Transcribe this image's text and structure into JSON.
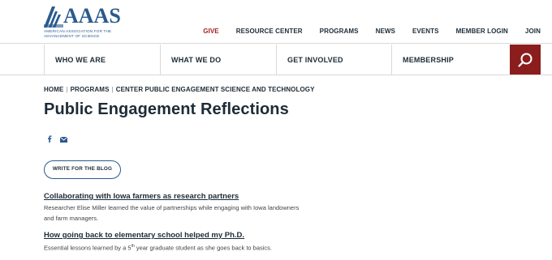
{
  "logo": {
    "word": "AAAS",
    "subtitle": "American Association for the Advancement of Science"
  },
  "utility_nav": [
    {
      "label": "GIVE",
      "accent": "#a32020"
    },
    {
      "label": "RESOURCE CENTER"
    },
    {
      "label": "PROGRAMS"
    },
    {
      "label": "NEWS"
    },
    {
      "label": "EVENTS"
    },
    {
      "label": "MEMBER LOGIN"
    },
    {
      "label": "JOIN"
    }
  ],
  "main_nav": [
    {
      "label": "WHO WE ARE"
    },
    {
      "label": "WHAT WE DO"
    },
    {
      "label": "GET INVOLVED"
    },
    {
      "label": "MEMBERSHIP"
    }
  ],
  "search": {
    "icon": "search-icon",
    "color": "#8b1d1d"
  },
  "breadcrumb": [
    "HOME",
    "PROGRAMS",
    "CENTER PUBLIC ENGAGEMENT SCIENCE AND TECHNOLOGY"
  ],
  "page_title": "Public Engagement Reflections",
  "share_icons": [
    "facebook-icon",
    "email-icon"
  ],
  "cta": {
    "label": "WRITE FOR THE BLOG"
  },
  "articles": [
    {
      "title": "Collaborating with Iowa farmers as research partners",
      "description": "Researcher Elise Miller learned the value of partnerships while engaging with Iowa landowners and farm managers."
    },
    {
      "title": "How going back to elementary school helped my Ph.D.",
      "description_pre": "Essential lessons learned by a 5",
      "description_sup": "th",
      "description_post": " year graduate student as she goes back to basics."
    }
  ],
  "colors": {
    "brand_blue": "#2a5a8f",
    "text_dark": "#1d2b36",
    "accent_red": "#8b1d1d"
  }
}
